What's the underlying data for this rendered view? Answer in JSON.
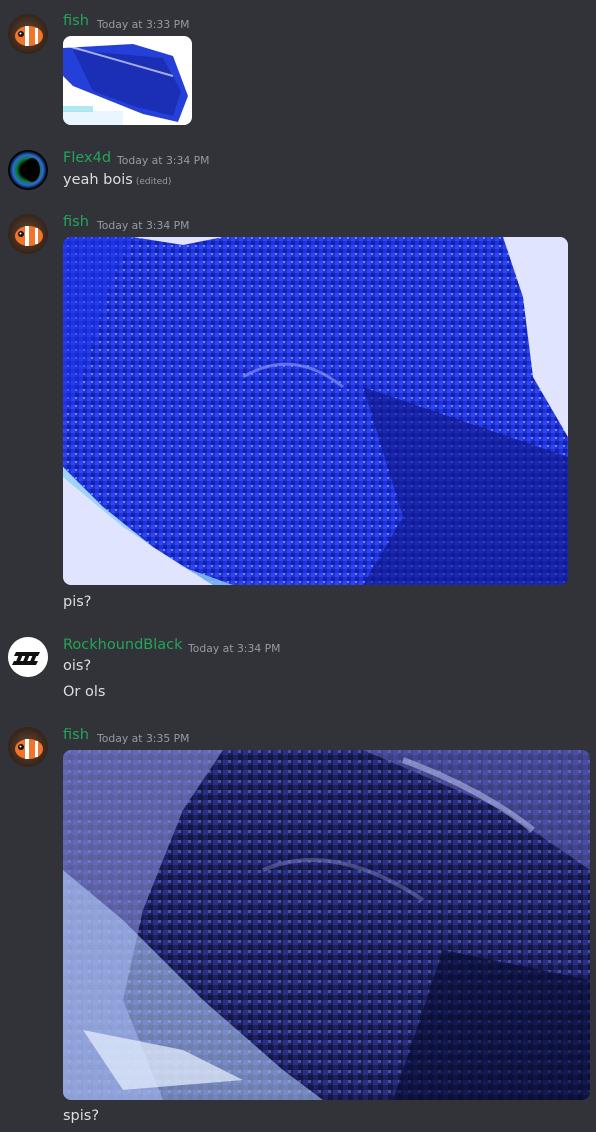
{
  "accent": {
    "username_color": "#23a55a",
    "text_color": "#dbdee1",
    "timestamp_color": "#949ba4",
    "background": "#313338"
  },
  "messages": [
    {
      "author": "fish",
      "timestamp": "Today at 3:33 PM",
      "avatar_icon": "clownfish-avatar-icon",
      "attachment": "image-attachment"
    },
    {
      "author": "Flex4d",
      "timestamp": "Today at 3:34 PM",
      "avatar_icon": "ring-avatar-icon",
      "text": "yeah bois",
      "edited": "(edited)"
    },
    {
      "author": "fish",
      "timestamp": "Today at 3:34 PM",
      "avatar_icon": "clownfish-avatar-icon",
      "attachment": "image-attachment",
      "text": "pis?"
    },
    {
      "author": "RockhoundBlack",
      "timestamp": "Today at 3:34 PM",
      "avatar_icon": "stripes-logo-avatar-icon",
      "text": "ois?",
      "text2": "Or ols"
    },
    {
      "author": "fish",
      "timestamp": "Today at 3:35 PM",
      "avatar_icon": "clownfish-avatar-icon",
      "attachment": "image-attachment",
      "text": "spis?"
    }
  ]
}
